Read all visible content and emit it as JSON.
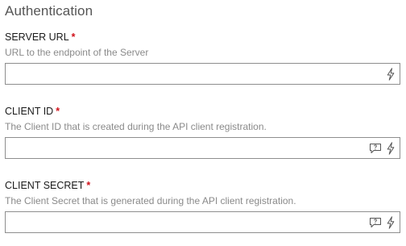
{
  "section": {
    "title": "Authentication"
  },
  "fields": [
    {
      "label": "SERVER URL",
      "required_mark": "*",
      "help": "URL to the endpoint of the Server",
      "value": "",
      "icons": [
        "lightning-icon"
      ]
    },
    {
      "label": "CLIENT ID",
      "required_mark": "*",
      "help": "The Client ID that is created during the API client registration.",
      "value": "",
      "icons": [
        "comment-question-icon",
        "lightning-icon"
      ]
    },
    {
      "label": "CLIENT SECRET",
      "required_mark": "*",
      "help": "The Client Secret that is generated during the API client registration.",
      "value": "",
      "icons": [
        "comment-question-icon",
        "lightning-icon"
      ]
    }
  ],
  "colors": {
    "required": "#d0121b",
    "help_text": "#8a8a8a",
    "border": "#8e8e8e"
  }
}
